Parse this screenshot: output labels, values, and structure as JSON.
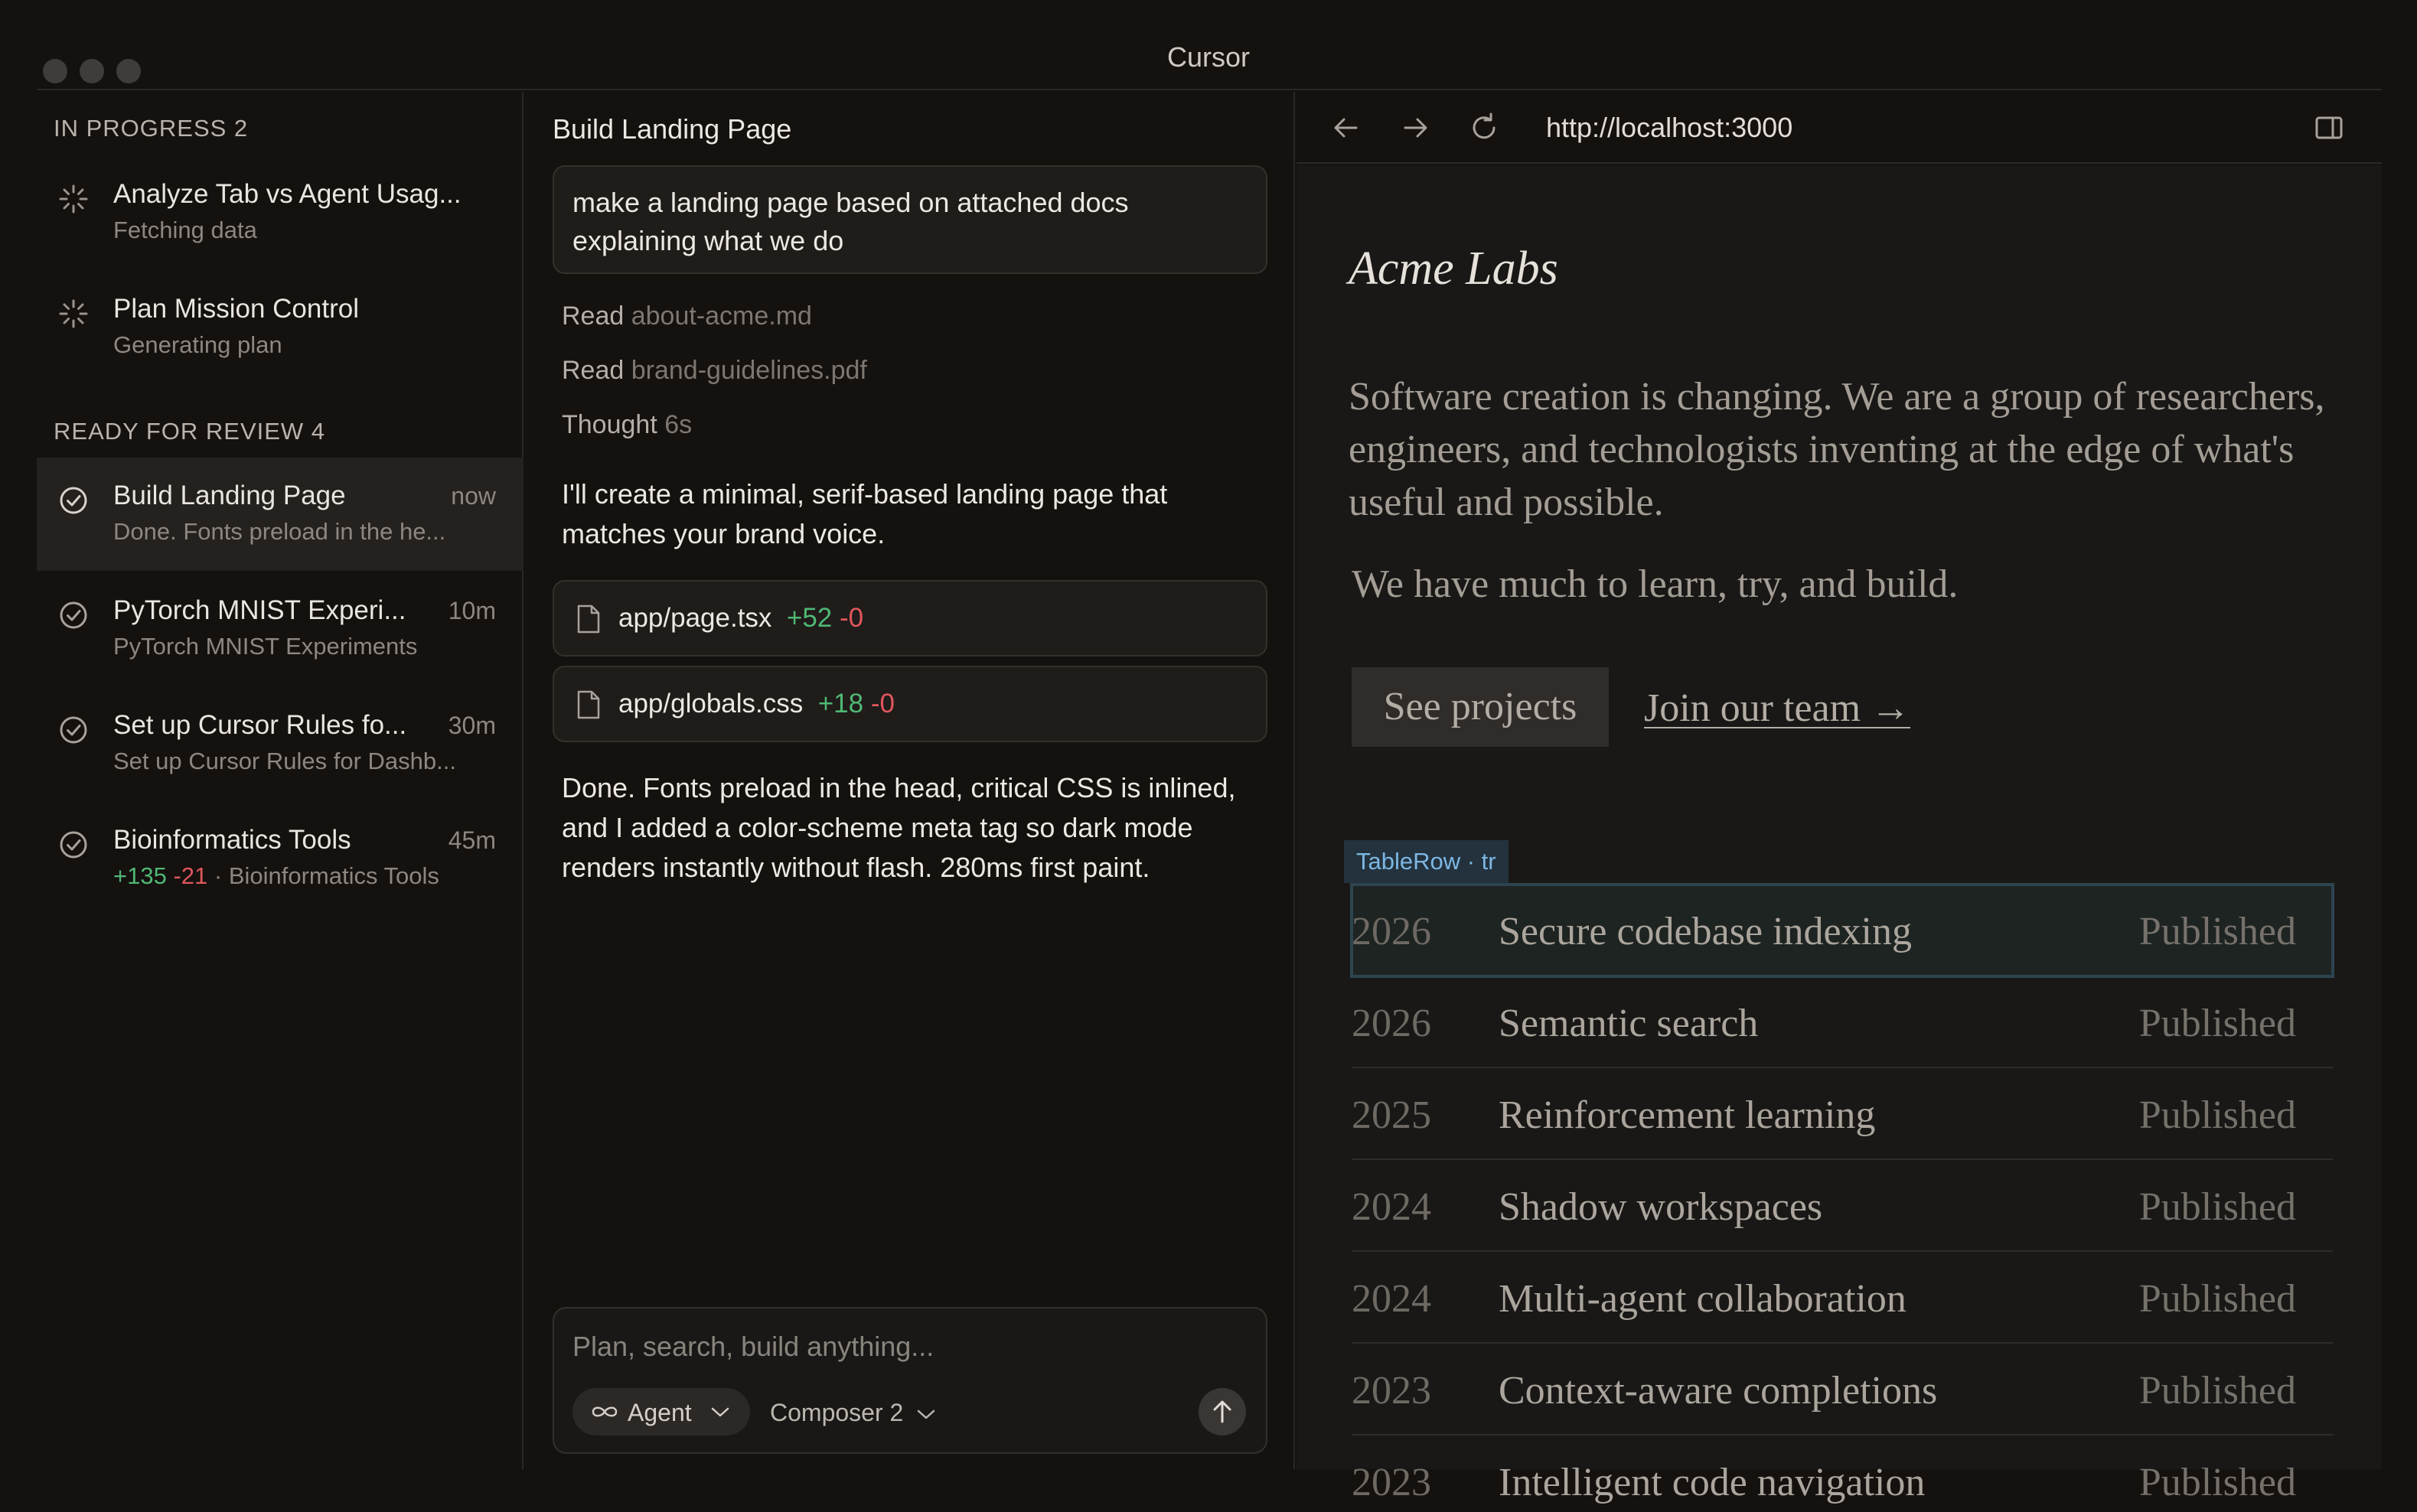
{
  "window": {
    "title": "Cursor"
  },
  "sidebar": {
    "in_progress_header": "IN PROGRESS 2",
    "ready_header": "READY FOR REVIEW 4",
    "in_progress": [
      {
        "title": "Analyze Tab vs Agent Usag...",
        "subtitle": "Fetching data",
        "icon": "spinner-icon"
      },
      {
        "title": "Plan Mission Control",
        "subtitle": "Generating plan",
        "icon": "spinner-icon"
      }
    ],
    "ready": [
      {
        "title": "Build Landing Page",
        "subtitle": "Done. Fonts preload in the he...",
        "time": "now",
        "icon": "check-circle-icon"
      },
      {
        "title": "PyTorch MNIST Experi...",
        "subtitle": "PyTorch MNIST Experiments",
        "time": "10m",
        "icon": "check-circle-icon"
      },
      {
        "title": "Set up Cursor Rules fo...",
        "subtitle": "Set up Cursor Rules for Dashb...",
        "time": "30m",
        "icon": "check-circle-icon"
      },
      {
        "title": "Bioinformatics Tools",
        "plus": "+135",
        "minus": "-21",
        "subtitle_rest": " · Bioinformatics Tools",
        "time": "45m",
        "icon": "check-circle-icon"
      }
    ]
  },
  "chat": {
    "title": "Build Landing Page",
    "user_message": "make a landing page based on attached docs explaining what we do",
    "steps": [
      {
        "verb": "Read",
        "detail": "about-acme.md"
      },
      {
        "verb": "Read",
        "detail": "brand-guidelines.pdf"
      },
      {
        "verb": "Thought",
        "detail": "6s"
      }
    ],
    "reply_1": "I'll create a minimal, serif-based landing page that matches your brand voice.",
    "files": [
      {
        "name": "app/page.tsx",
        "plus": "+52",
        "minus": "-0"
      },
      {
        "name": "app/globals.css",
        "plus": "+18",
        "minus": "-0"
      }
    ],
    "reply_2": "Done. Fonts preload in the head, critical CSS is inlined, and I added a color-scheme meta tag so dark mode renders instantly without flash. 280ms first paint.",
    "composer": {
      "placeholder": "Plan, search, build anything...",
      "mode": "Agent",
      "model": "Composer 2"
    }
  },
  "browser": {
    "url": "http://localhost:3000",
    "site": {
      "logo": "Acme Labs",
      "hero": "Software creation is changing. We are a group of researchers, engineers, and technologists inventing at the edge of what's useful and possible.",
      "hero2": "We have much to learn, try, and build.",
      "primary_button": "See projects",
      "secondary_link": "Join our team →",
      "inspector_tag": "TableRow · tr",
      "rows": [
        {
          "year": "2026",
          "name": "Secure codebase indexing",
          "status": "Published"
        },
        {
          "year": "2026",
          "name": "Semantic search",
          "status": "Published"
        },
        {
          "year": "2025",
          "name": "Reinforcement learning",
          "status": "Published"
        },
        {
          "year": "2024",
          "name": "Shadow workspaces",
          "status": "Published"
        },
        {
          "year": "2024",
          "name": "Multi-agent collaboration",
          "status": "Published"
        },
        {
          "year": "2023",
          "name": "Context-aware completions",
          "status": "Published"
        },
        {
          "year": "2023",
          "name": "Intelligent code navigation",
          "status": "Published"
        }
      ]
    }
  }
}
